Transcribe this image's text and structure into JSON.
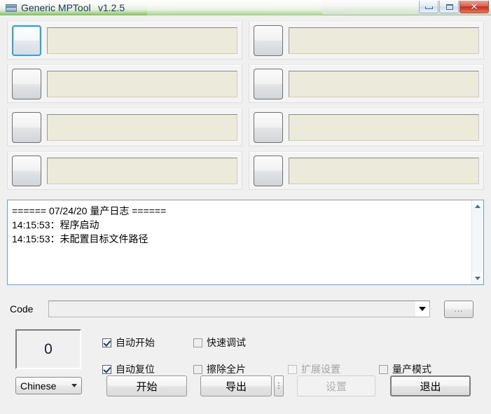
{
  "window": {
    "title": "Generic MPTool",
    "version": "v1.2.5",
    "icon": "app-icon",
    "minimize_label": "",
    "maximize_label": "",
    "close_label": "✕"
  },
  "slots": [
    {
      "id": 1,
      "focused": true,
      "value": ""
    },
    {
      "id": 2,
      "focused": false,
      "value": ""
    },
    {
      "id": 3,
      "focused": false,
      "value": ""
    },
    {
      "id": 4,
      "focused": false,
      "value": ""
    },
    {
      "id": 5,
      "focused": false,
      "value": ""
    },
    {
      "id": 6,
      "focused": false,
      "value": ""
    },
    {
      "id": 7,
      "focused": false,
      "value": ""
    },
    {
      "id": 8,
      "focused": false,
      "value": ""
    }
  ],
  "log": {
    "lines": [
      "====== 07/24/20 量产日志 ======",
      "14:15:53：程序启动",
      "14:15:53：未配置目标文件路径"
    ],
    "text": "====== 07/24/20 量产日志 ======\n14:15:53：程序启动\n14:15:53：未配置目标文件路径",
    "scroll_up_icon": "chevron-up-icon",
    "scroll_down_icon": "chevron-down-icon"
  },
  "code_row": {
    "label": "Code",
    "value": "",
    "placeholder": "",
    "dropdown_icon": "chevron-down-icon",
    "browse_label": "..."
  },
  "counter": {
    "value": "0"
  },
  "options": [
    {
      "label": "自动开始",
      "checked": true,
      "disabled": false,
      "name": "auto-start"
    },
    {
      "label": "快速调试",
      "checked": false,
      "disabled": false,
      "name": "fast-debug"
    },
    {
      "label": "扩展设置",
      "checked": false,
      "disabled": true,
      "name": "extended-settings"
    },
    {
      "label": "量产模式",
      "checked": false,
      "disabled": false,
      "name": "mass-production-mode"
    },
    {
      "label": "自动复位",
      "checked": true,
      "disabled": false,
      "name": "auto-reset"
    },
    {
      "label": "擦除全片",
      "checked": false,
      "disabled": false,
      "name": "erase-full-chip"
    }
  ],
  "bottom": {
    "language": "Chinese",
    "language_arrow_icon": "chevron-down-icon",
    "start_label": "开始",
    "export_label": "导出",
    "more_label": "⋮",
    "settings_label": "设置",
    "exit_label": "退出"
  },
  "colors": {
    "title_gradient_green": "#7cc24f",
    "close_red": "#c42d19",
    "slot_field": "#eceadb",
    "focus_blue": "#3aa0d8",
    "log_border": "#7f9db9"
  }
}
